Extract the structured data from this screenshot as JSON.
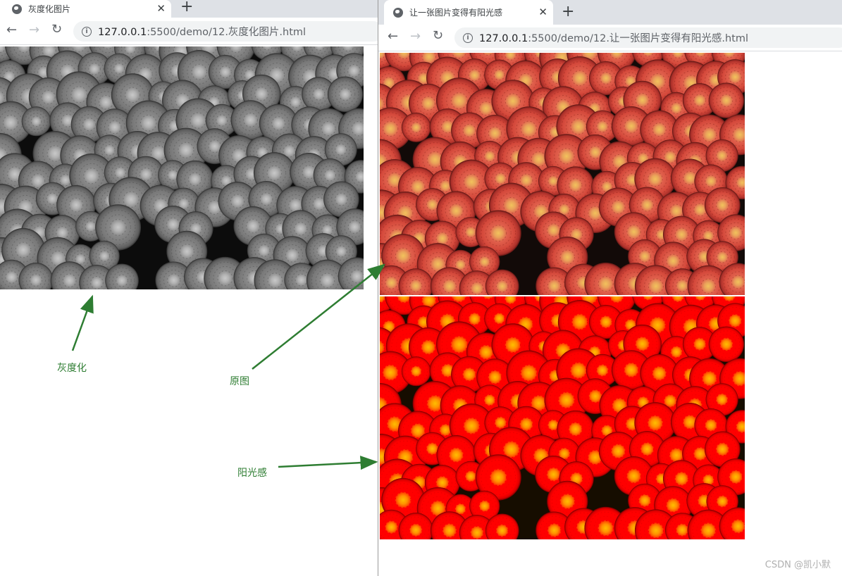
{
  "left_window": {
    "tab_title": "灰度化图片",
    "url_host": "127.0.0.1",
    "url_path": ":5500/demo/12.灰度化图片.html",
    "image_style": "grayscale"
  },
  "right_window": {
    "tab_title": "让一张图片变得有阳光感",
    "url_host": "127.0.0.1",
    "url_path": ":5500/demo/12.让一张图片变得有阳光感.html",
    "images": [
      {
        "name": "original",
        "style": "original"
      },
      {
        "name": "sunny",
        "style": "saturated"
      }
    ]
  },
  "annotations": {
    "grayscale_label": "灰度化",
    "original_label": "原图",
    "sunny_label": "阳光感",
    "color": "#2e7d32"
  },
  "watermark": "CSDN @凯小默",
  "icons": {
    "tab_icon": "globe-icon",
    "tab_close": "close-icon",
    "new_tab": "plus-icon",
    "back": "back-arrow-icon",
    "forward": "forward-arrow-icon",
    "reload": "reload-icon",
    "info": "info-icon"
  }
}
